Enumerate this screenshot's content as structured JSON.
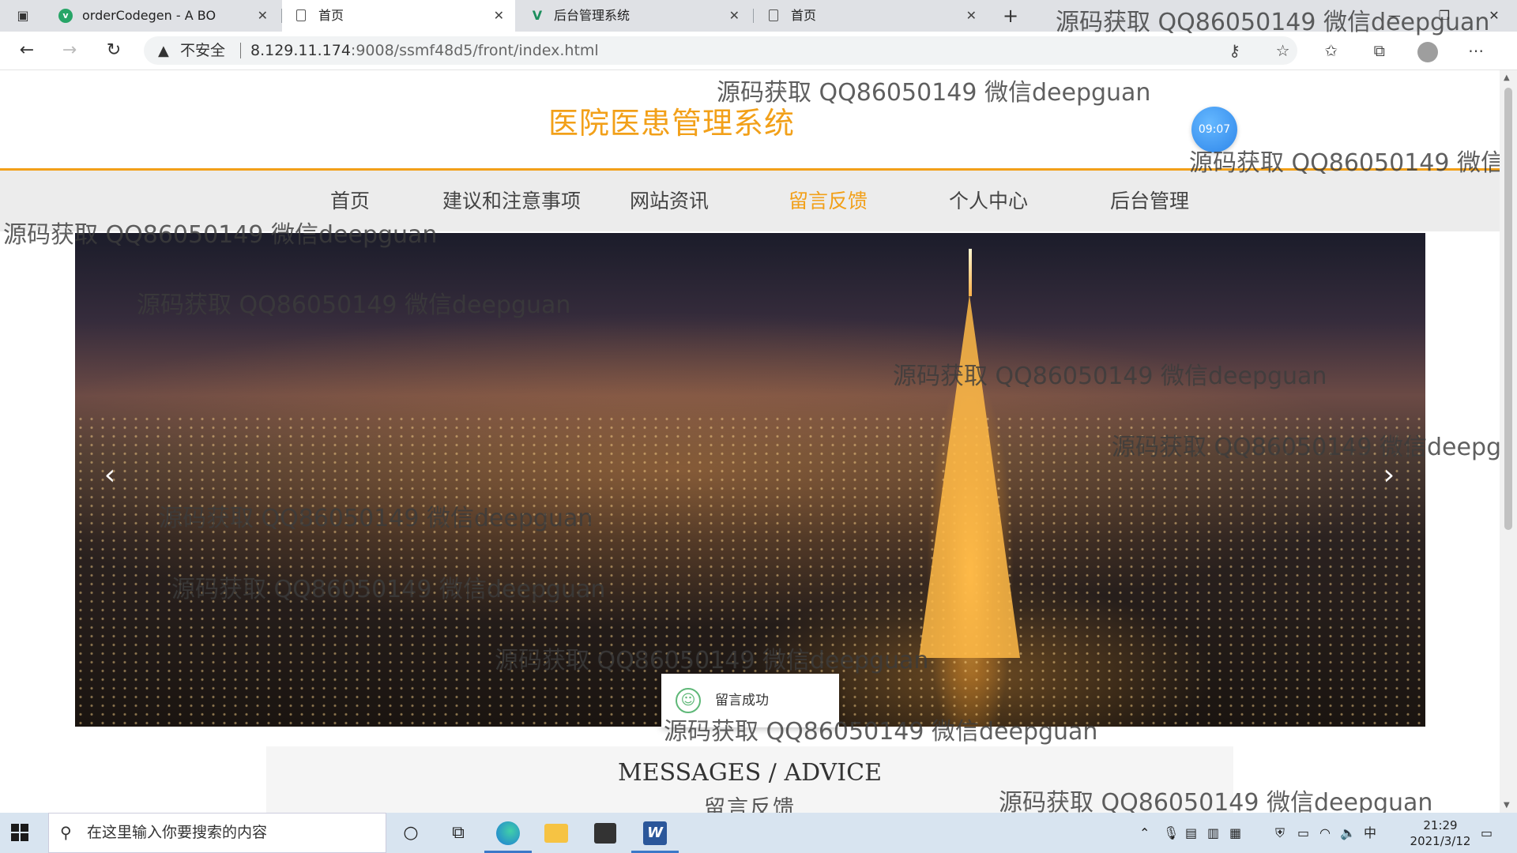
{
  "browser": {
    "tabs": [
      {
        "title": "orderCodegen - A BO",
        "favicon": "v-logo-icon"
      },
      {
        "title": "首页",
        "favicon": "page-icon"
      },
      {
        "title": "后台管理系统",
        "favicon": "v-logo-icon"
      },
      {
        "title": "首页",
        "favicon": "page-icon"
      }
    ],
    "security_label": "不安全",
    "url_host": "8.129.11.174",
    "url_rest": ":9008/ssmf48d5/front/index.html"
  },
  "site": {
    "title": "医院医患管理系统",
    "clock": "09:07",
    "nav": [
      {
        "label": "首页"
      },
      {
        "label": "建议和注意事项"
      },
      {
        "label": "网站资讯"
      },
      {
        "label": "留言反馈"
      },
      {
        "label": "个人中心"
      },
      {
        "label": "后台管理"
      }
    ],
    "active_nav": "留言反馈",
    "accent_color": "#f2a019",
    "carousel": {
      "prev_icon": "‹",
      "next_icon": "›"
    },
    "toast": {
      "message": "留言成功"
    },
    "section": {
      "title_en": "MESSAGES / ADVICE",
      "title_cn": "留言反馈"
    },
    "watermark": "源码获取 QQ86050149 微信deepguan"
  },
  "taskbar": {
    "search_placeholder": "在这里输入你要搜索的内容",
    "time": "21:29",
    "date": "2021/3/12",
    "ime": "中"
  }
}
